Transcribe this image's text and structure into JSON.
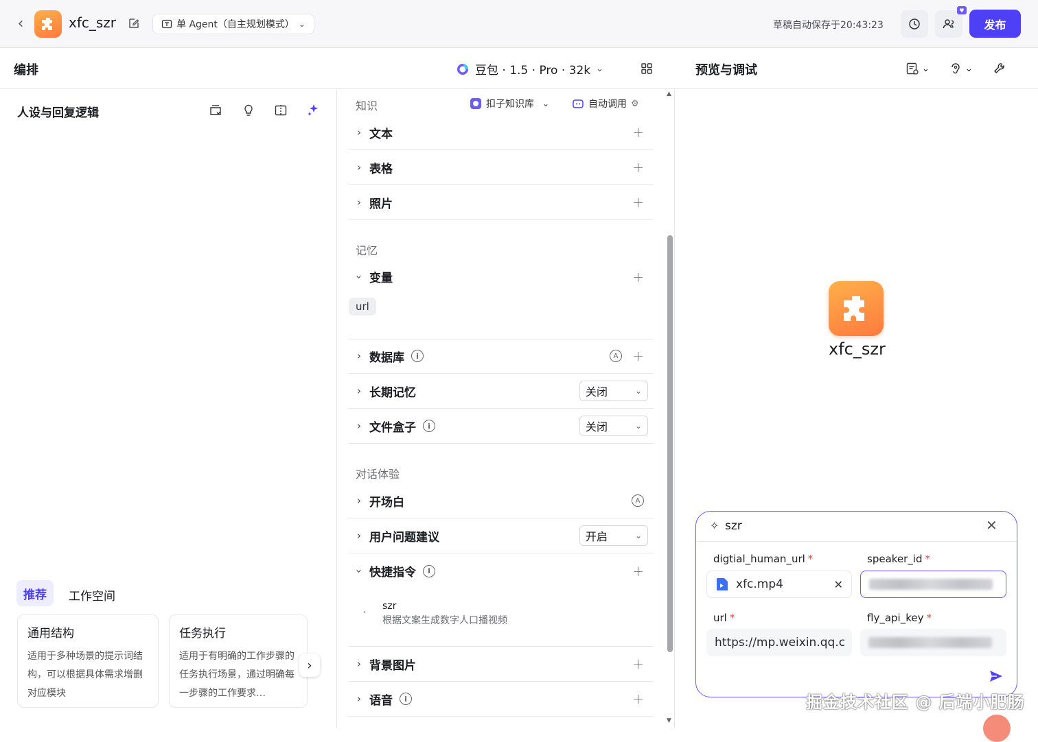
{
  "topbar": {
    "app_name": "xfc_szr",
    "mode_label": "单 Agent（自主规划模式）",
    "autosave": "草稿自动保存于20:43:23",
    "publish_label": "发布"
  },
  "left": {
    "header_title": "编排",
    "section_title": "人设与回复逻辑",
    "tabs": [
      "推荐",
      "工作空间"
    ],
    "cards": [
      {
        "title": "通用结构",
        "desc": "适用于多种场景的提示词结构，可以根据具体需求增删对应模块"
      },
      {
        "title": "任务执行",
        "desc": "适用于有明确的工作步骤的任务执行场景，通过明确每一步骤的工作要求…"
      }
    ]
  },
  "model": {
    "name": "豆包 · 1.5 · Pro · 32k"
  },
  "middle": {
    "knowledge": {
      "label": "知识",
      "source": "扣子知识库",
      "auto": "自动调用",
      "rows": [
        "文本",
        "表格",
        "照片"
      ]
    },
    "memory": {
      "label": "记忆",
      "variable_row": "变量",
      "variable_tag": "url",
      "database_row": "数据库",
      "long_memory_row": "长期记忆",
      "long_memory_value": "关闭",
      "filebox_row": "文件盒子",
      "filebox_value": "关闭"
    },
    "dialog": {
      "label": "对话体验",
      "opening_row": "开场白",
      "suggest_row": "用户问题建议",
      "suggest_value": "开启",
      "shortcut_row": "快捷指令",
      "shortcut_name": "szr",
      "shortcut_desc": "根据文案生成数字人口播视频",
      "bg_row": "背景图片",
      "voice_row": "语音"
    }
  },
  "right": {
    "header_title": "预览与调试",
    "bot_name": "xfc_szr",
    "command": {
      "name": "szr",
      "fields": [
        {
          "label": "digtial_human_url",
          "value": "xfc.mp4"
        },
        {
          "label": "speaker_id",
          "value": ""
        },
        {
          "label": "url",
          "value": "https://mp.weixin.qq.c"
        },
        {
          "label": "fly_api_key",
          "value": ""
        }
      ]
    },
    "watermark": "掘金技术社区 @ 后端小肥肠"
  },
  "colors": {
    "accent": "#4e40f5",
    "logo": "#ff8a3d",
    "required": "#f0434b"
  }
}
